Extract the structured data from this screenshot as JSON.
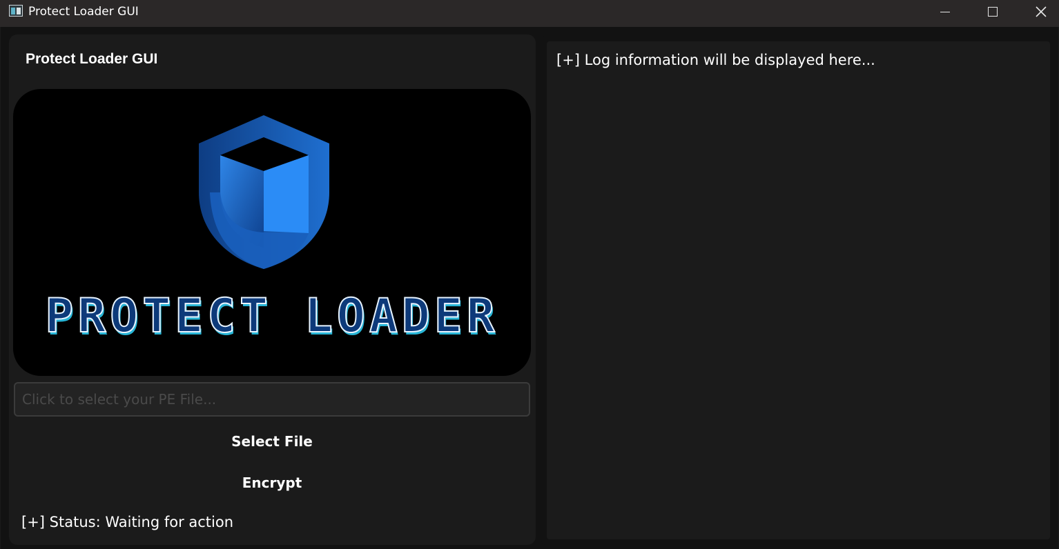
{
  "window": {
    "title": "Protect Loader GUI",
    "controls": [
      "minimize-icon",
      "maximize-icon",
      "close-icon"
    ]
  },
  "left_panel": {
    "title": "Protect Loader GUI",
    "banner": {
      "logo_text": "PROTECT LOADER",
      "icon": "shield-icon",
      "colors": {
        "shield_light": "#2e8bf0",
        "shield_dark": "#0b3f86",
        "text_fill": "#0d3a7a",
        "text_accent": "#27b5d6"
      }
    },
    "file_input": {
      "value": "",
      "placeholder": "Click to select your PE File..."
    },
    "select_button_label": "Select File",
    "encrypt_button_label": "Encrypt",
    "status": "[+] Status: Waiting for action"
  },
  "right_panel": {
    "log": "[+] Log information will be displayed here..."
  },
  "colors": {
    "background": "#121212",
    "panel": "#1b1b1b",
    "titlebar": "#2b2828",
    "text": "#ffffff"
  }
}
